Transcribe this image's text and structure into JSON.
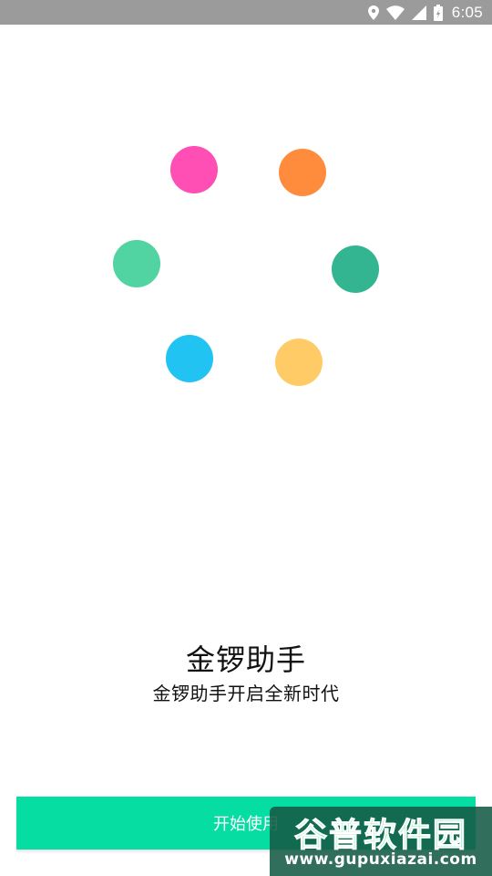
{
  "status_bar": {
    "time": "6:05",
    "icons": [
      "location-icon",
      "wifi-icon",
      "signal-icon",
      "battery-icon"
    ]
  },
  "splash": {
    "dots": [
      {
        "name": "dot-pink",
        "color": "#ff4fb4"
      },
      {
        "name": "dot-orange",
        "color": "#ff8c3c"
      },
      {
        "name": "dot-mint",
        "color": "#52d3a2"
      },
      {
        "name": "dot-teal",
        "color": "#34b592"
      },
      {
        "name": "dot-blue",
        "color": "#21c3f3"
      },
      {
        "name": "dot-yellow",
        "color": "#ffcb66"
      }
    ]
  },
  "title": "金锣助手",
  "subtitle": "金锣助手开启全新时代",
  "start_button": {
    "label": "开始使用",
    "color": "#06dda3"
  },
  "watermark": {
    "text": "谷普软件园",
    "url": "www.gupuxiazai.com"
  }
}
